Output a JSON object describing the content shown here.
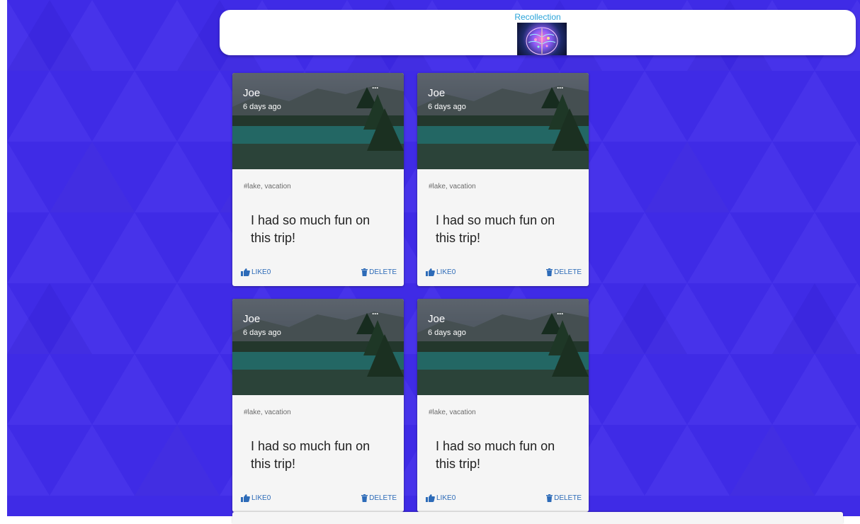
{
  "app": {
    "title": "Recollection",
    "colors": {
      "background": "#3f2be6",
      "accent": "#2aa3d8",
      "action": "#2d6bb8"
    }
  },
  "posts": [
    {
      "author": "Joe",
      "time": "6 days ago",
      "tags": "#lake, vacation",
      "message": "I had so much fun on this trip!",
      "like_label": "LIKE",
      "like_count": "0",
      "delete_label": "DELETE"
    },
    {
      "author": "Joe",
      "time": "6 days ago",
      "tags": "#lake, vacation",
      "message": "I had so much fun on this trip!",
      "like_label": "LIKE",
      "like_count": "0",
      "delete_label": "DELETE"
    },
    {
      "author": "Joe",
      "time": "6 days ago",
      "tags": "#lake, vacation",
      "message": "I had so much fun on this trip!",
      "like_label": "LIKE",
      "like_count": "0",
      "delete_label": "DELETE"
    },
    {
      "author": "Joe",
      "time": "6 days ago",
      "tags": "#lake, vacation",
      "message": "I had so much fun on this trip!",
      "like_label": "LIKE",
      "like_count": "0",
      "delete_label": "DELETE"
    }
  ],
  "icons": {
    "more": "more-horizontal-icon",
    "like": "thumb-up-icon",
    "delete": "trash-icon"
  }
}
